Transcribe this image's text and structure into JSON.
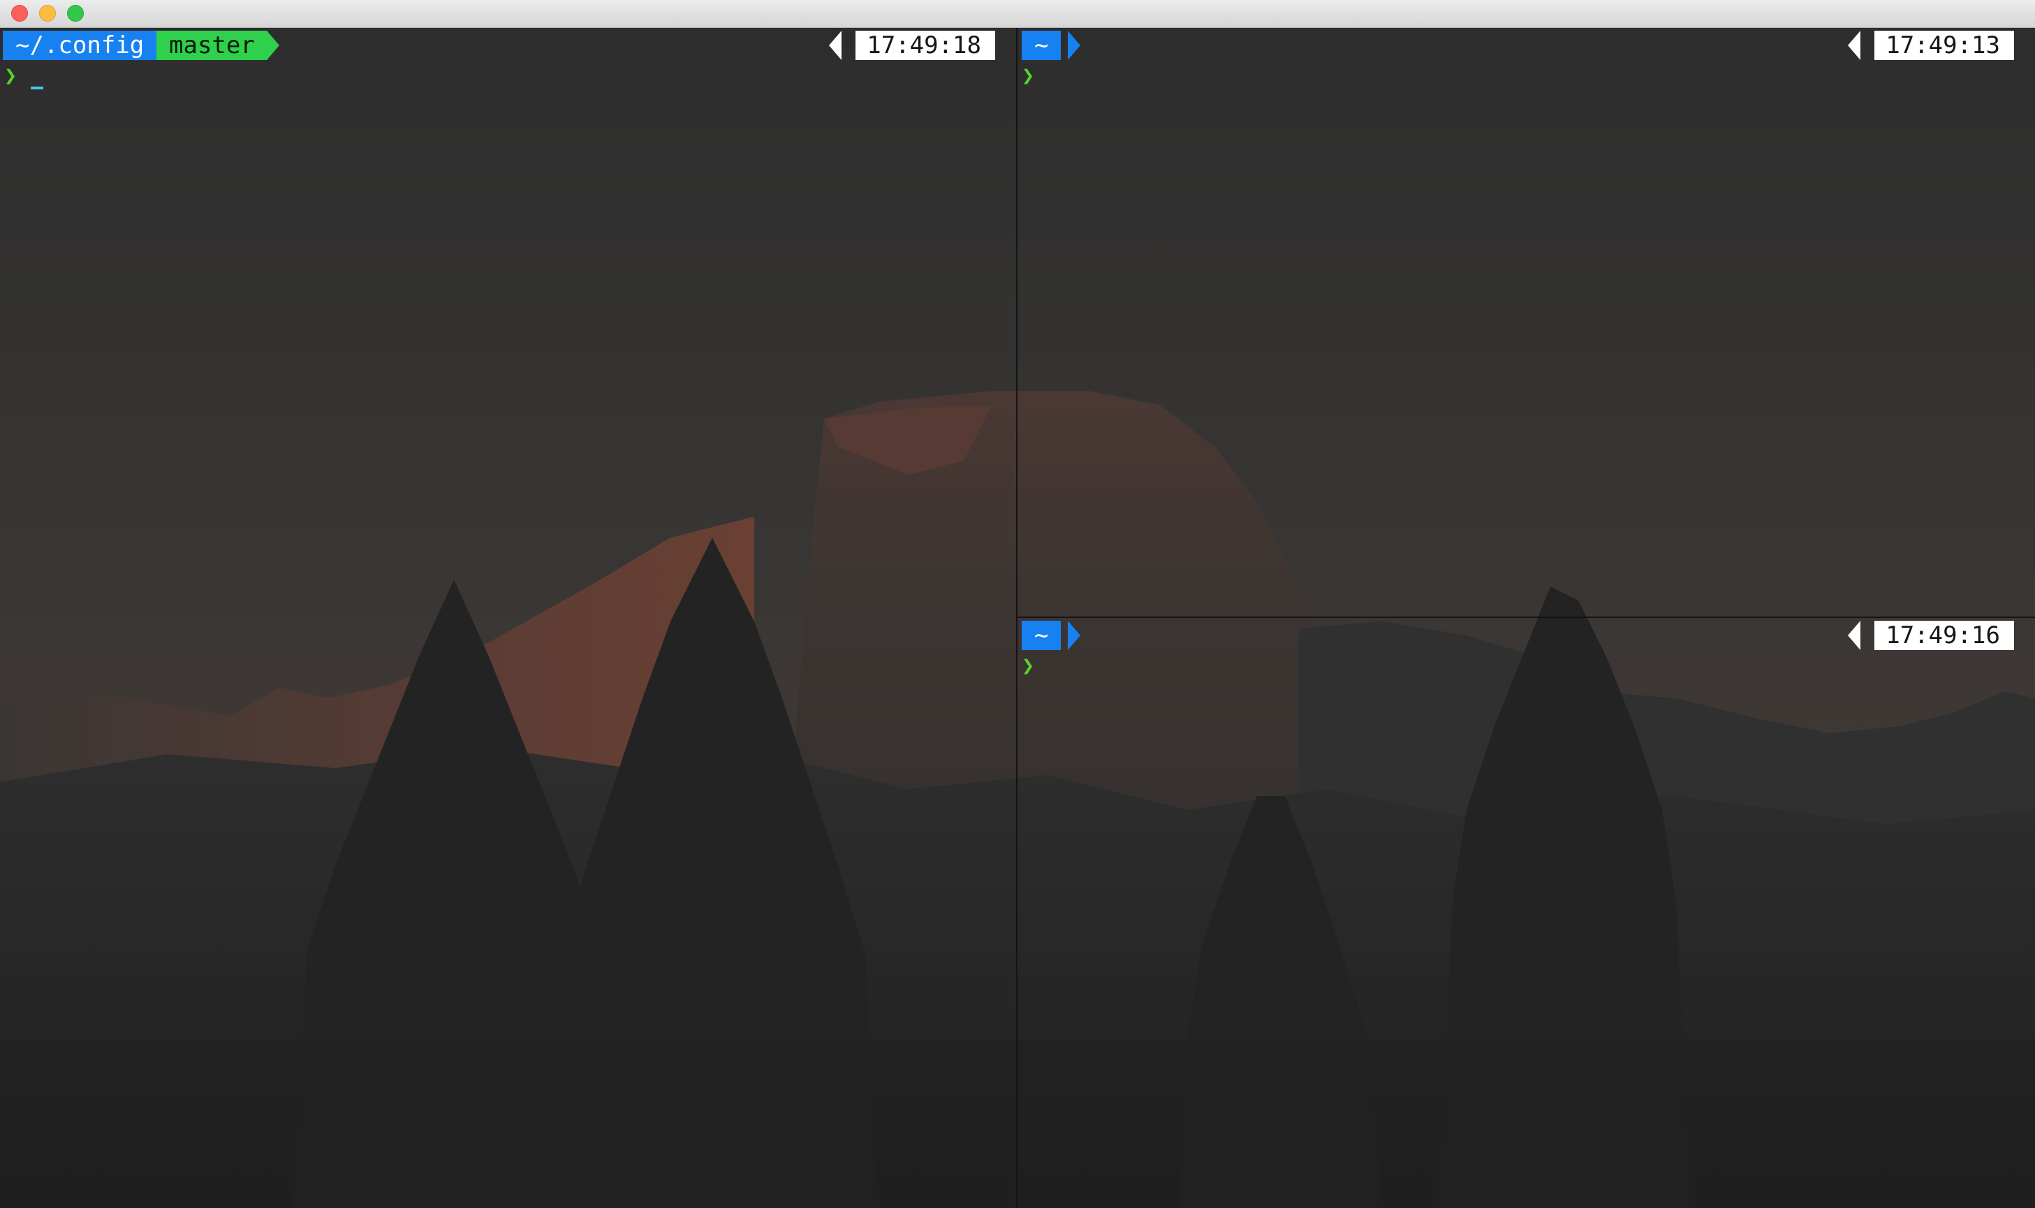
{
  "window": {
    "buttons": {
      "close": "close",
      "minimize": "minimize",
      "zoom": "zoom"
    }
  },
  "panes": {
    "left": {
      "path": "~/.config",
      "branch": "master",
      "prompt": "❯",
      "time": "17:49:18"
    },
    "top_right": {
      "path": "~",
      "prompt": "❯",
      "time": "17:49:13"
    },
    "bottom_right": {
      "path": "~",
      "prompt": "❯",
      "time": "17:49:16"
    }
  },
  "colors": {
    "path_segment": "#1781f2",
    "branch_segment": "#2fd14c",
    "prompt_char": "#55d32a",
    "time_segment": "#ffffff",
    "cursor": "#44c8f0"
  },
  "icons": {
    "close": "traffic-light-red",
    "minimize": "traffic-light-yellow",
    "zoom": "traffic-light-green",
    "wallpaper": "half-dome-landscape-image"
  }
}
